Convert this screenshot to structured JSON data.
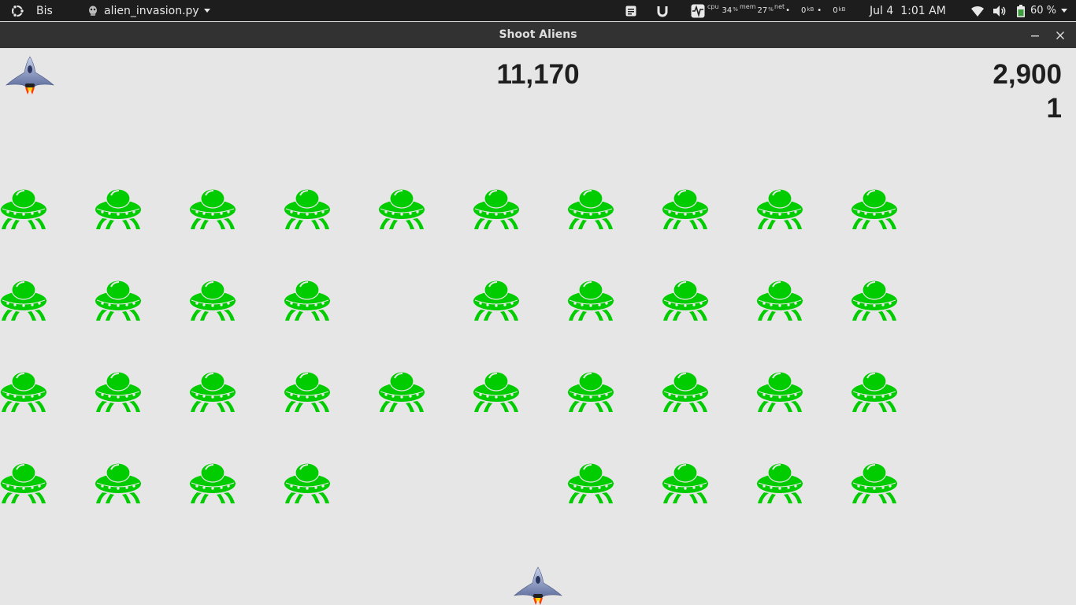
{
  "panel": {
    "workspace_label": "Bis",
    "app_menu_label": "alien_invasion.py",
    "cpu_label": "cpu",
    "cpu_value": "34",
    "cpu_unit": "%",
    "mem_label": "mem",
    "mem_value": "27",
    "mem_unit": "%",
    "net_label": "net",
    "net_down_value": "0",
    "net_up_value": "0",
    "net_unit": "kB",
    "date": "Jul 4",
    "time": "1:01 AM",
    "battery": "60 %"
  },
  "window": {
    "title": "Shoot Aliens"
  },
  "game": {
    "score": "11,170",
    "high_score": "2,900",
    "level": "1",
    "ships_left": 1,
    "colors": {
      "background": "#e6e6e6",
      "alien": "#00cc00",
      "text": "#1e1e1e"
    },
    "aliens": [
      [
        1,
        1,
        1,
        1,
        1,
        1,
        1,
        1,
        1,
        1
      ],
      [
        1,
        1,
        1,
        1,
        0,
        1,
        1,
        1,
        1,
        1
      ],
      [
        1,
        1,
        1,
        1,
        1,
        1,
        1,
        1,
        1,
        1
      ],
      [
        1,
        1,
        1,
        1,
        0,
        0,
        1,
        1,
        1,
        1
      ]
    ]
  }
}
